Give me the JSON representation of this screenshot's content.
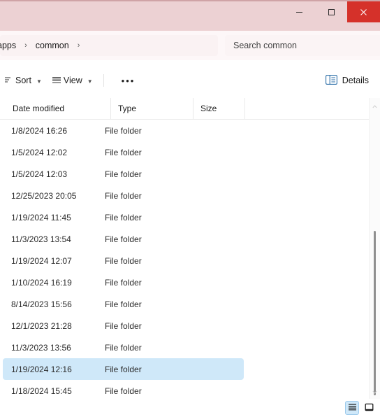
{
  "titlebar": {
    "minimize_label": "Minimize",
    "maximize_label": "Maximize",
    "close_label": "Close",
    "accent_bg": "#ecd1d3",
    "close_bg": "#d5312a"
  },
  "address": {
    "crumbs": [
      "apps",
      "common"
    ],
    "separator": "›",
    "trailing_separator": "›"
  },
  "search": {
    "placeholder": "Search common"
  },
  "toolbar": {
    "sort_label": "Sort",
    "view_label": "View",
    "overflow_label": "•••",
    "details_label": "Details"
  },
  "columns": [
    {
      "key": "date",
      "label": "Date modified"
    },
    {
      "key": "type",
      "label": "Type"
    },
    {
      "key": "size",
      "label": "Size"
    },
    {
      "key": "blank",
      "label": ""
    }
  ],
  "rows": [
    {
      "date": "1/8/2024 16:26",
      "type": "File folder",
      "size": "",
      "selected": false
    },
    {
      "date": "1/5/2024 12:02",
      "type": "File folder",
      "size": "",
      "selected": false
    },
    {
      "date": "1/5/2024 12:03",
      "type": "File folder",
      "size": "",
      "selected": false
    },
    {
      "date": "12/25/2023 20:05",
      "type": "File folder",
      "size": "",
      "selected": false
    },
    {
      "date": "1/19/2024 11:45",
      "type": "File folder",
      "size": "",
      "selected": false
    },
    {
      "date": "11/3/2023 13:54",
      "type": "File folder",
      "size": "",
      "selected": false
    },
    {
      "date": "1/19/2024 12:07",
      "type": "File folder",
      "size": "",
      "selected": false
    },
    {
      "date": "1/10/2024 16:19",
      "type": "File folder",
      "size": "",
      "selected": false
    },
    {
      "date": "8/14/2023 15:56",
      "type": "File folder",
      "size": "",
      "selected": false
    },
    {
      "date": "12/1/2023 21:28",
      "type": "File folder",
      "size": "",
      "selected": false
    },
    {
      "date": "11/3/2023 13:56",
      "type": "File folder",
      "size": "",
      "selected": false
    },
    {
      "date": "1/19/2024 12:16",
      "type": "File folder",
      "size": "",
      "selected": true
    },
    {
      "date": "1/18/2024 15:45",
      "type": "File folder",
      "size": "",
      "selected": false
    }
  ],
  "statusbar": {
    "details_view_label": "Details view",
    "large_icons_view_label": "Large icons view",
    "active_view": "details"
  },
  "colors": {
    "selection": "#cfe8f9",
    "selection_border": "#9ecbec",
    "accent_icon": "#2d6fa8"
  }
}
